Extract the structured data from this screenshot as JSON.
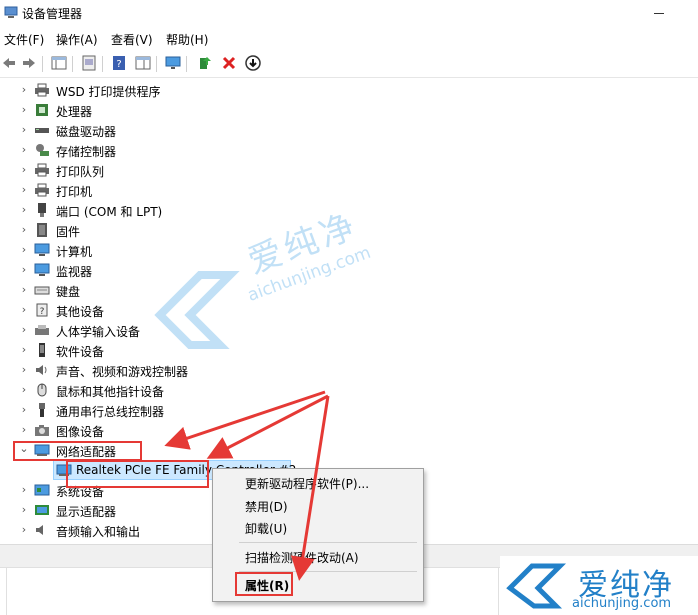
{
  "window": {
    "title": "设备管理器"
  },
  "menu": [
    "文件(F)",
    "操作(A)",
    "查看(V)",
    "帮助(H)"
  ],
  "toolbar": [
    "back-icon",
    "forward-icon",
    "properties-view-icon",
    "show-hidden-icon",
    "help-icon",
    "console-tree-icon",
    "monitor-icon",
    "update-driver-icon",
    "uninstall-icon",
    "download-icon"
  ],
  "tree": [
    {
      "label": "WSD 打印提供程序",
      "icon": "printer-icon"
    },
    {
      "label": "处理器",
      "icon": "processor-icon"
    },
    {
      "label": "磁盘驱动器",
      "icon": "disk-drive-icon"
    },
    {
      "label": "存储控制器",
      "icon": "storage-controller-icon"
    },
    {
      "label": "打印队列",
      "icon": "printer-icon"
    },
    {
      "label": "打印机",
      "icon": "printer-icon"
    },
    {
      "label": "端口 (COM 和 LPT)",
      "icon": "port-icon"
    },
    {
      "label": "固件",
      "icon": "firmware-icon"
    },
    {
      "label": "计算机",
      "icon": "computer-icon"
    },
    {
      "label": "监视器",
      "icon": "monitor-icon"
    },
    {
      "label": "键盘",
      "icon": "keyboard-icon"
    },
    {
      "label": "其他设备",
      "icon": "other-device-icon"
    },
    {
      "label": "人体学输入设备",
      "icon": "hid-icon"
    },
    {
      "label": "软件设备",
      "icon": "software-device-icon"
    },
    {
      "label": "声音、视频和游戏控制器",
      "icon": "sound-icon"
    },
    {
      "label": "鼠标和其他指针设备",
      "icon": "mouse-icon"
    },
    {
      "label": "通用串行总线控制器",
      "icon": "usb-icon"
    },
    {
      "label": "图像设备",
      "icon": "camera-icon"
    },
    {
      "label": "网络适配器",
      "icon": "network-adapter-icon",
      "expanded": true,
      "children": [
        {
          "label": "Realtek PCIe FE Family Controller #2",
          "icon": "network-adapter-icon"
        }
      ]
    },
    {
      "label": "系统设备",
      "icon": "system-device-icon"
    },
    {
      "label": "显示适配器",
      "icon": "display-adapter-icon"
    },
    {
      "label": "音频输入和输出",
      "icon": "audio-io-icon"
    }
  ],
  "context_menu": {
    "items": [
      "更新驱动程序软件(P)...",
      "禁用(D)",
      "卸载(U)",
      "扫描检测硬件改动(A)",
      "属性(R)"
    ]
  },
  "watermark": {
    "title": "爱纯净",
    "url": "aichunjing.com"
  },
  "logo": {
    "title": "爱纯净",
    "url": "aichunjing.com"
  },
  "colors": {
    "highlight_red": "#e53935",
    "selection": "#cce8ff",
    "brand_blue": "#2280c8"
  }
}
